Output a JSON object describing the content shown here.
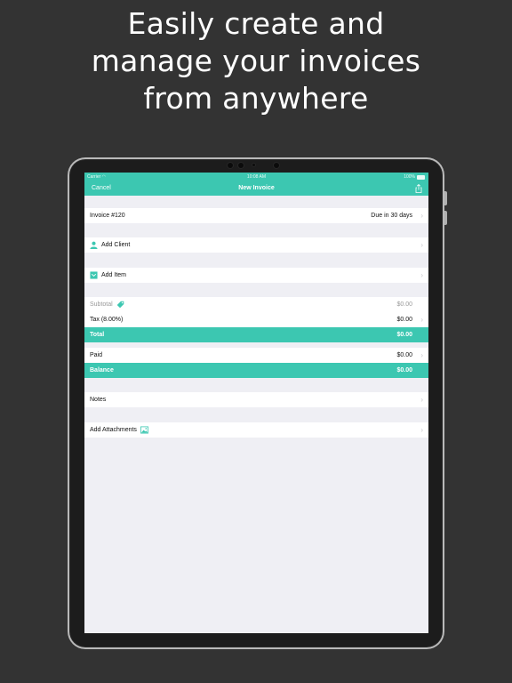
{
  "headline": {
    "line1": "Easily create and",
    "line2": "manage your invoices",
    "line3": "from anywhere"
  },
  "status_bar": {
    "carrier": "Carrier",
    "time": "10:08 AM",
    "battery": "100%"
  },
  "nav": {
    "cancel_label": "Cancel",
    "title": "New Invoice",
    "share_icon": "share-icon"
  },
  "invoice": {
    "number_label": "Invoice #120",
    "due_label": "Due in 30 days"
  },
  "client": {
    "label": "Add Client",
    "icon": "person-icon"
  },
  "item": {
    "label": "Add Item",
    "icon": "box-icon"
  },
  "totals": {
    "subtotal_label": "Subtotal",
    "subtotal_value": "$0.00",
    "tax_label": "Tax (8.00%)",
    "tax_value": "$0.00",
    "total_label": "Total",
    "total_value": "$0.00",
    "paid_label": "Paid",
    "paid_value": "$0.00",
    "balance_label": "Balance",
    "balance_value": "$0.00"
  },
  "notes": {
    "label": "Notes"
  },
  "attachments": {
    "label": "Add Attachments",
    "icon": "image-icon"
  },
  "colors": {
    "accent": "#3cc7b1",
    "background": "#333333",
    "screen_bg": "#efeff4"
  }
}
